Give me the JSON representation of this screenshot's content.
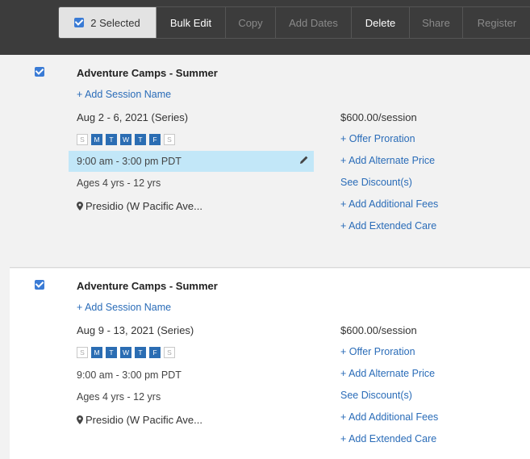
{
  "toolbar": {
    "selected_label": "2 Selected",
    "buttons": [
      "Bulk Edit",
      "Copy",
      "Add Dates",
      "Delete",
      "Share",
      "Register"
    ]
  },
  "sessions": [
    {
      "title": "Adventure Camps - Summer",
      "add_session_name": "+ Add Session Name",
      "dates": "Aug 2 - 6, 2021 (Series)",
      "days": [
        "S",
        "M",
        "T",
        "W",
        "T",
        "F",
        "S"
      ],
      "time": "9:00 am - 3:00 pm PDT",
      "ages": "Ages 4 yrs - 12 yrs",
      "location": "Presidio (W Pacific Ave...",
      "price": "$600.00/session",
      "links": [
        "+ Offer Proration",
        "+ Add Alternate Price",
        "See Discount(s)",
        "+ Add Additional Fees",
        "+ Add Extended Care"
      ]
    },
    {
      "title": "Adventure Camps - Summer",
      "add_session_name": "+ Add Session Name",
      "dates": "Aug 9 - 13, 2021 (Series)",
      "days": [
        "S",
        "M",
        "T",
        "W",
        "T",
        "F",
        "S"
      ],
      "time": "9:00 am - 3:00 pm PDT",
      "ages": "Ages 4 yrs - 12 yrs",
      "location": "Presidio (W Pacific Ave...",
      "price": "$600.00/session",
      "links": [
        "+ Offer Proration",
        "+ Add Alternate Price",
        "See Discount(s)",
        "+ Add Additional Fees",
        "+ Add Extended Care"
      ]
    }
  ]
}
